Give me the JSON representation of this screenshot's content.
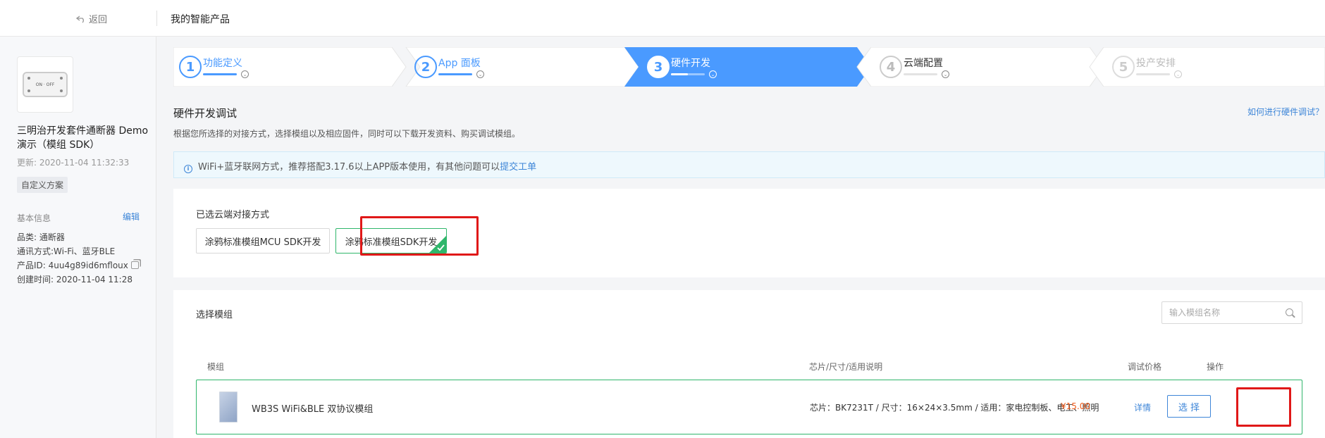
{
  "topbar": {
    "back_label": "返回",
    "title": "我的智能产品"
  },
  "sidebar": {
    "device_label": "ON · OFF",
    "product_name": "三明治开发套件通断器 Demo 演示（模组 SDK）",
    "updated": "更新: 2020-11-04 11:32:33",
    "tag": "自定义方案",
    "basic_title": "基本信息",
    "edit_label": "编辑",
    "category": "品类: 通断器",
    "comm": "通讯方式:Wi-Fi、蓝牙BLE",
    "product_id": "产品ID: 4uu4g89id6mfloux",
    "created": "创建时间: 2020-11-04 11:28"
  },
  "steps": [
    {
      "num": "1",
      "label": "功能定义",
      "state": "done",
      "progress": 1.0
    },
    {
      "num": "2",
      "label": "App 面板",
      "state": "done",
      "progress": 1.0
    },
    {
      "num": "3",
      "label": "硬件开发",
      "state": "active",
      "progress": 0.5
    },
    {
      "num": "4",
      "label": "云端配置",
      "state": "pending",
      "progress": 0
    },
    {
      "num": "5",
      "label": "投产安排",
      "state": "disabled",
      "progress": 0
    }
  ],
  "header": {
    "title": "硬件开发调试",
    "help_link": "如何进行硬件调试？",
    "subtitle": "根据您所选择的对接方式，选择模组以及相应固件，同时可以下载开发资料、购买调试模组。"
  },
  "notice": {
    "text": "WiFi+蓝牙联网方式，推荐搭配3.17.6以上APP版本使用，有其他问题可以",
    "link": "提交工单"
  },
  "connection": {
    "title": "已选云端对接方式",
    "options": [
      {
        "label": "涂鸦标准模组MCU SDK开发",
        "selected": false
      },
      {
        "label": "涂鸦标准模组SDK开发",
        "selected": true
      }
    ]
  },
  "module_select": {
    "title": "选择模组",
    "search_placeholder": "输入模组名称",
    "columns": [
      "模组",
      "芯片/尺寸/适用说明",
      "调试价格",
      "操作"
    ],
    "rows": [
      {
        "name": "WB3S WiFi&BLE 双协议模组",
        "desc": "芯片：BK7231T / 尺寸：16×24×3.5mm / 适用：家电控制板、电工、照明",
        "price": "¥15.00",
        "detail": "详情",
        "action": "选 择"
      }
    ]
  },
  "colors": {
    "accent": "#4a9aff",
    "link": "#3e86d8",
    "success": "#2fb66b",
    "price": "#f05a1a",
    "highlight": "#e01818"
  }
}
